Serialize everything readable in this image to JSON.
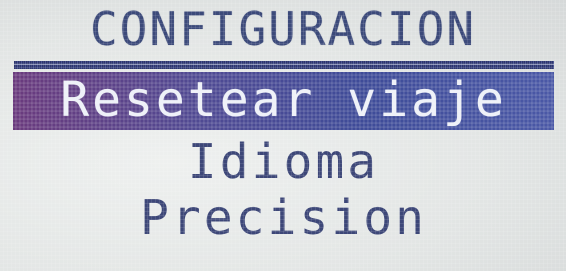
{
  "screen": {
    "title": "CONFIGURACION"
  },
  "menu": {
    "items": [
      {
        "label": "Resetear viaje",
        "selected": true
      },
      {
        "label": "Idioma",
        "selected": false
      },
      {
        "label": "Precision",
        "selected": false
      }
    ]
  },
  "colors": {
    "text": "#3d4778",
    "highlight_start": "#6a3a7d",
    "highlight_end": "#4a58a6",
    "background": "#e3e6e5"
  }
}
